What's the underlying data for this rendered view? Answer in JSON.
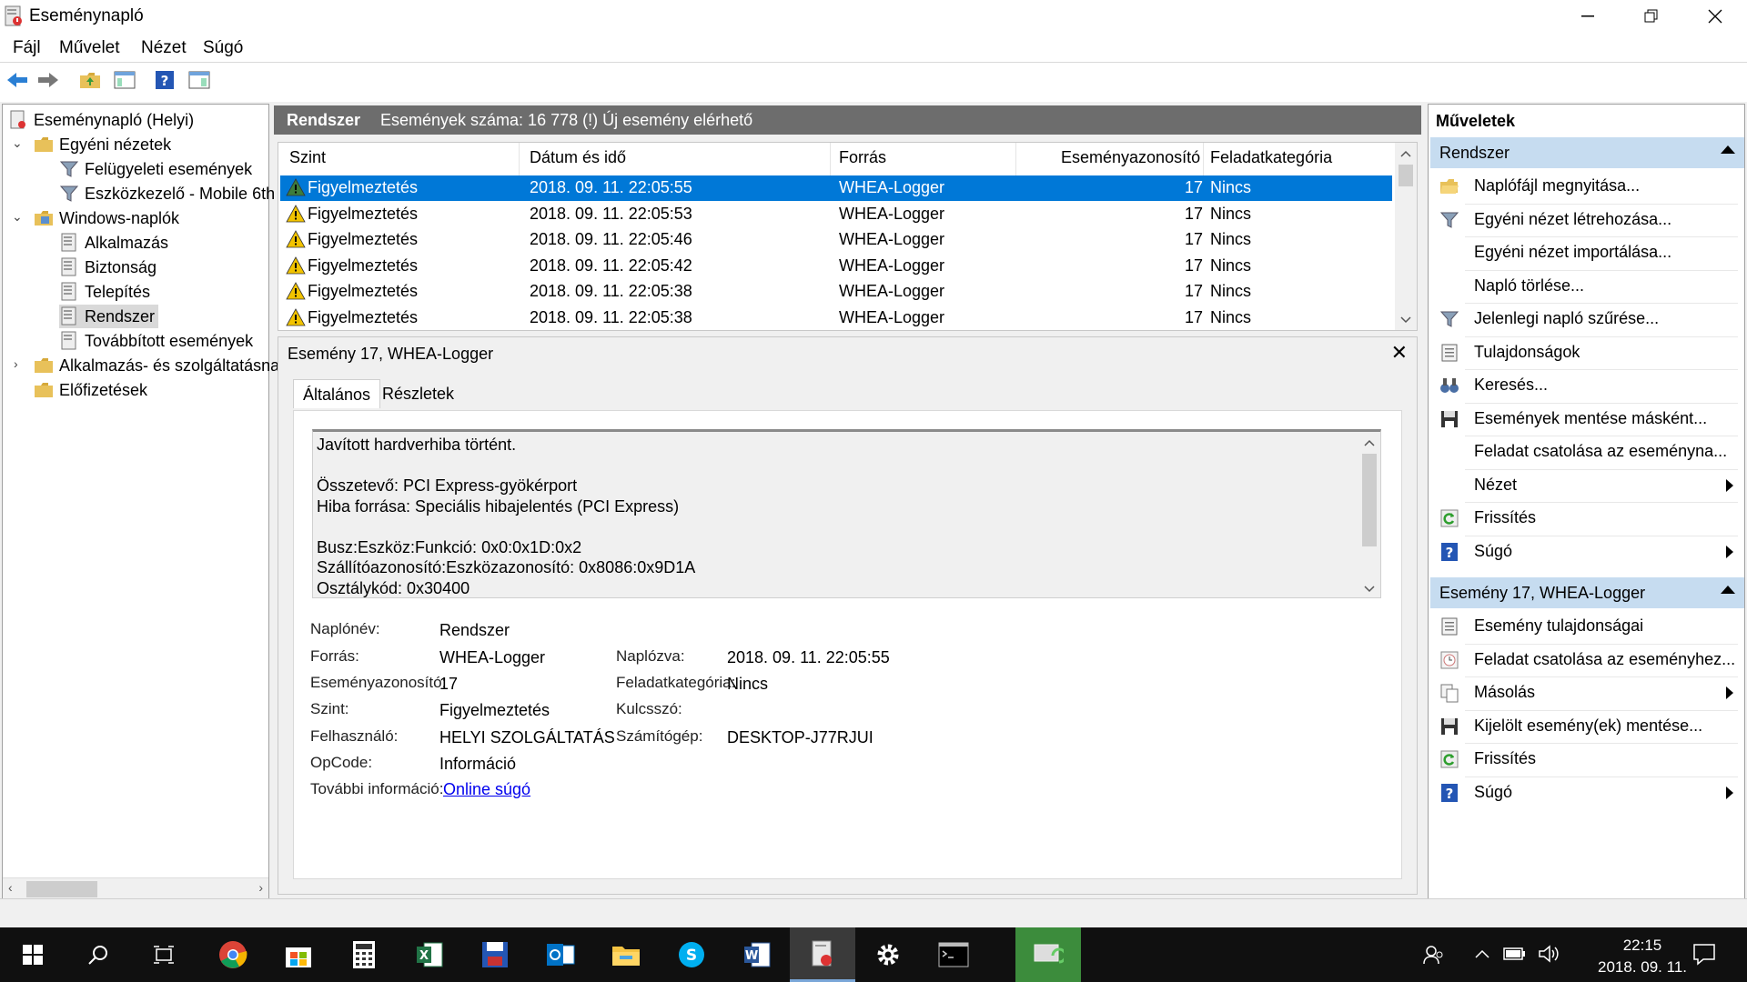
{
  "window": {
    "title": "Eseménynapló"
  },
  "menu": {
    "items": [
      "Fájl",
      "Művelet",
      "Nézet",
      "Súgó"
    ]
  },
  "tree": {
    "root": "Eseménynapló (Helyi)",
    "custom_views": "Egyéni nézetek",
    "admin_events": "Felügyeleti események",
    "device_manager": "Eszközkezelő - Mobile 6th",
    "windows_logs": "Windows-naplók",
    "application": "Alkalmazás",
    "security": "Biztonság",
    "setup": "Telepítés",
    "system": "Rendszer",
    "forwarded": "Továbbított események",
    "app_service_logs": "Alkalmazás- és szolgáltatásna",
    "subscriptions": "Előfizetések"
  },
  "center": {
    "log_name": "Rendszer",
    "event_count": "Események száma: 16 778 (!) Új esemény elérhető",
    "columns": [
      "Szint",
      "Dátum és idő",
      "Forrás",
      "Eseményazonosító",
      "Feladatkategória"
    ],
    "rows": [
      {
        "level": "Figyelmeztetés",
        "datetime": "2018. 09. 11. 22:05:55",
        "source": "WHEA-Logger",
        "id": "17",
        "category": "Nincs"
      },
      {
        "level": "Figyelmeztetés",
        "datetime": "2018. 09. 11. 22:05:53",
        "source": "WHEA-Logger",
        "id": "17",
        "category": "Nincs"
      },
      {
        "level": "Figyelmeztetés",
        "datetime": "2018. 09. 11. 22:05:46",
        "source": "WHEA-Logger",
        "id": "17",
        "category": "Nincs"
      },
      {
        "level": "Figyelmeztetés",
        "datetime": "2018. 09. 11. 22:05:42",
        "source": "WHEA-Logger",
        "id": "17",
        "category": "Nincs"
      },
      {
        "level": "Figyelmeztetés",
        "datetime": "2018. 09. 11. 22:05:38",
        "source": "WHEA-Logger",
        "id": "17",
        "category": "Nincs"
      },
      {
        "level": "Figyelmeztetés",
        "datetime": "2018. 09. 11. 22:05:38",
        "source": "WHEA-Logger",
        "id": "17",
        "category": "Nincs"
      }
    ]
  },
  "detail": {
    "title": "Esemény 17, WHEA-Logger",
    "tab_general": "Általános",
    "tab_details": "Részletek",
    "message_lines": [
      "Javított hardverhiba történt.",
      "",
      "Összetevő: PCI Express-gyökérport",
      "Hiba forrása: Speciális hibajelentés (PCI Express)",
      "",
      "Busz:Eszköz:Funkció: 0x0:0x1D:0x2",
      "Szállítóazonosító:Eszközazonosító: 0x8086:0x9D1A",
      "Osztálykód: 0x30400"
    ],
    "labels": {
      "log_name": "Naplónév:",
      "source": "Forrás:",
      "event_id": "Eseményazonosító:",
      "level": "Szint:",
      "user": "Felhasználó:",
      "opcode": "OpCode:",
      "more_info": "További információ:",
      "logged": "Naplózva:",
      "task_category": "Feladatkategória:",
      "keywords": "Kulcsszó:",
      "computer": "Számítógép:"
    },
    "values": {
      "log_name": "Rendszer",
      "source": "WHEA-Logger",
      "event_id": "17",
      "level": "Figyelmeztetés",
      "user": "HELYI SZOLGÁLTATÁS",
      "opcode": "Információ",
      "more_info_link": "Online súgó",
      "logged": "2018. 09. 11. 22:05:55",
      "task_category": "Nincs",
      "keywords": "",
      "computer": "DESKTOP-J77RJUI"
    }
  },
  "actions": {
    "header": "Műveletek",
    "section1": "Rendszer",
    "section1_items": [
      {
        "label": "Naplófájl megnyitása...",
        "icon": "folder-open-icon"
      },
      {
        "label": "Egyéni nézet létrehozása...",
        "icon": "filter-icon"
      },
      {
        "label": "Egyéni nézet importálása...",
        "icon": ""
      },
      {
        "label": "Napló törlése...",
        "icon": ""
      },
      {
        "label": "Jelenlegi napló szűrése...",
        "icon": "filter-icon"
      },
      {
        "label": "Tulajdonságok",
        "icon": "properties-icon"
      },
      {
        "label": "Keresés...",
        "icon": "binoculars-icon"
      },
      {
        "label": "Események mentése másként...",
        "icon": "save-icon"
      },
      {
        "label": "Feladat csatolása az eseménynа...",
        "icon": ""
      },
      {
        "label": "Nézet",
        "icon": ""
      },
      {
        "label": "Frissítés",
        "icon": "refresh-icon"
      },
      {
        "label": "Súgó",
        "icon": "help-icon"
      }
    ],
    "section2": "Esemény 17, WHEA-Logger",
    "section2_items": [
      {
        "label": "Esemény tulajdonságai",
        "icon": "properties-icon"
      },
      {
        "label": "Feladat csatolása az eseményhez...",
        "icon": "task-icon"
      },
      {
        "label": "Másolás",
        "icon": "copy-icon"
      },
      {
        "label": "Kijelölt esemény(ek) mentése...",
        "icon": "save-icon"
      },
      {
        "label": "Frissítés",
        "icon": "refresh-icon"
      },
      {
        "label": "Súgó",
        "icon": "help-icon"
      }
    ]
  },
  "taskbar": {
    "time": "22:15",
    "date": "2018. 09. 11."
  },
  "colors": {
    "selection": "#0078d7",
    "header_bg": "#6d6d6d",
    "section_bg": "#c6dcf0",
    "taskbar_bg": "#101010"
  }
}
